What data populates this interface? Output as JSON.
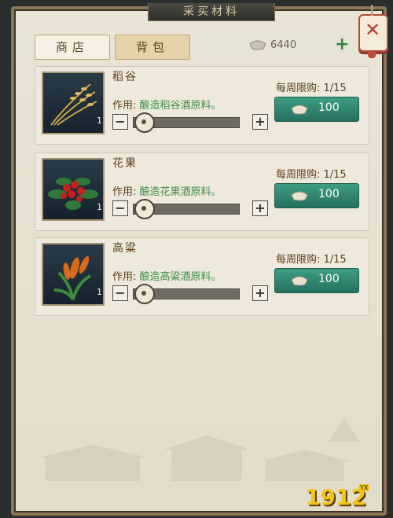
{
  "window": {
    "title": "采买材料"
  },
  "tabs": [
    {
      "label": "商店"
    },
    {
      "label": "背包"
    }
  ],
  "currency": {
    "amount": "6440",
    "icon": "silver-ingot-icon",
    "add_icon": "plus-icon"
  },
  "items": [
    {
      "name": "稻谷",
      "effect_label": "作用:",
      "effect_text": "酿造稻谷酒原料。",
      "limit": "每周限购: 1/15",
      "price": "100",
      "qty": "1"
    },
    {
      "name": "花果",
      "effect_label": "作用:",
      "effect_text": "酿造花果酒原料。",
      "limit": "每周限购: 1/15",
      "price": "100",
      "qty": "1"
    },
    {
      "name": "高粱",
      "effect_label": "作用:",
      "effect_text": "酿造高粱酒原料。",
      "limit": "每周限购: 1/15",
      "price": "100",
      "qty": "1"
    }
  ],
  "stepper": {
    "minus": "−",
    "plus": "+"
  },
  "watermark": {
    "text": "1912",
    "tag": "YX"
  },
  "colors": {
    "accent_green": "#2e8a49",
    "buy_button": "#2f8a72",
    "close_red": "#c23a2e"
  }
}
